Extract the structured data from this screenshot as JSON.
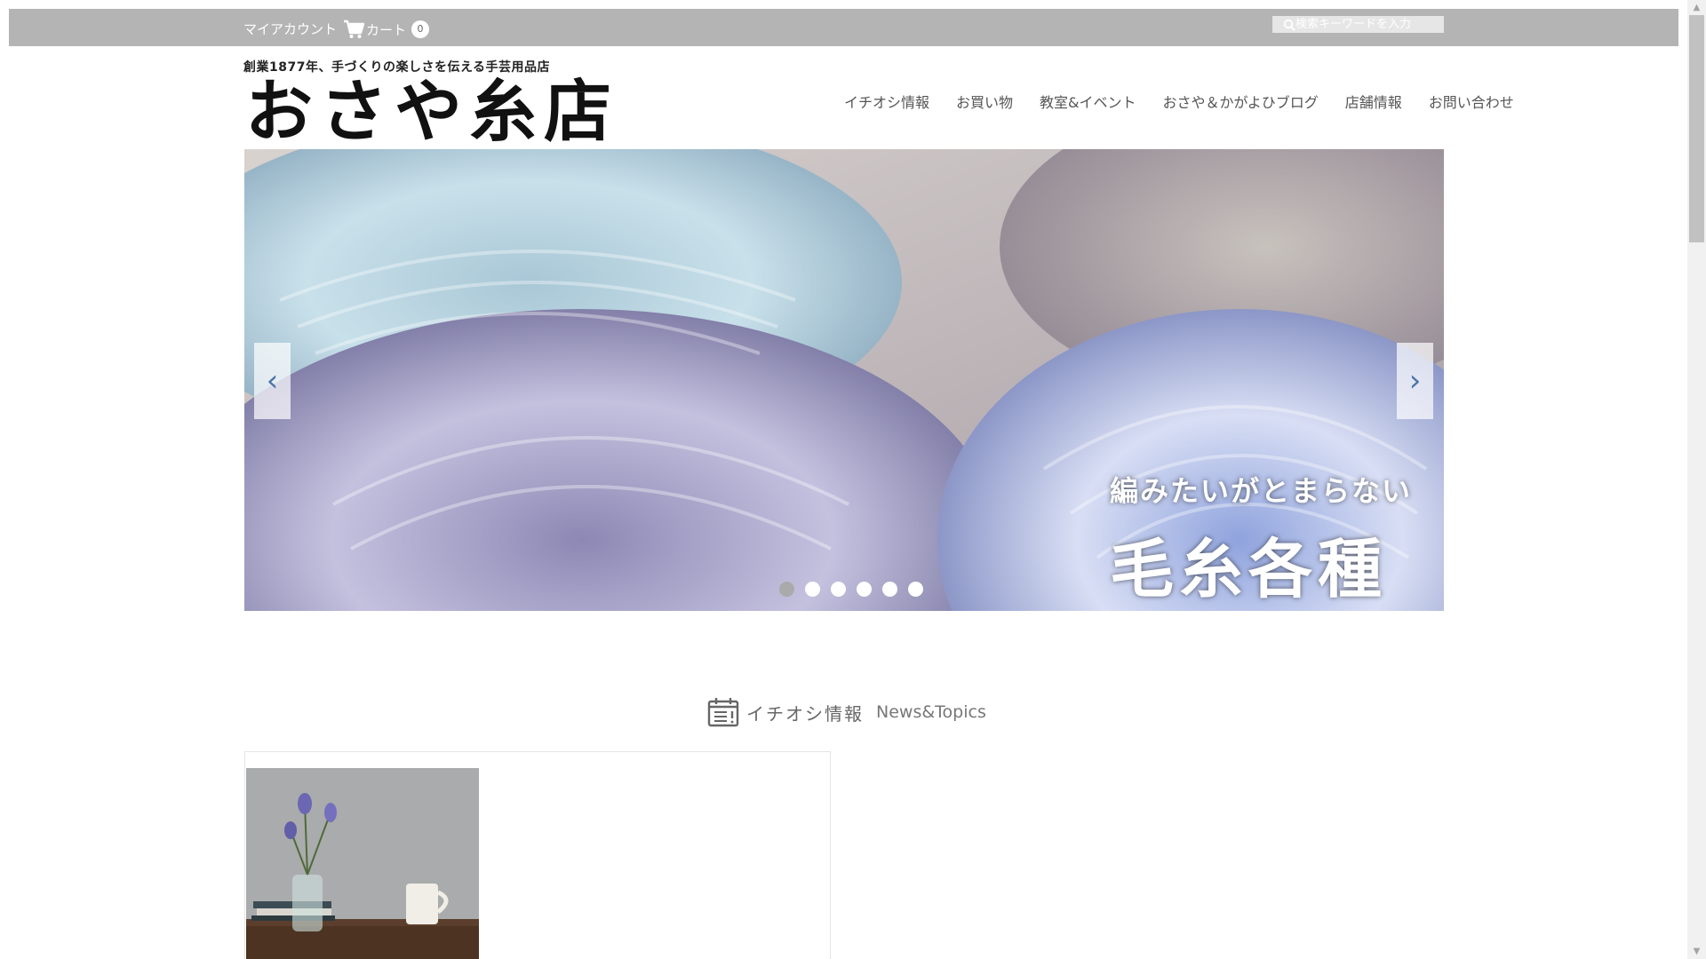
{
  "topbar": {
    "account_label": "マイアカウント",
    "cart_label": "カート",
    "cart_count": "0",
    "search_placeholder": "検索キーワードを入力"
  },
  "header": {
    "tagline": "創業1877年、手づくりの楽しさを伝える手芸用品店",
    "logo_text": "おさや糸店"
  },
  "nav": {
    "items": [
      {
        "label": "イチオシ情報"
      },
      {
        "label": "お買い物"
      },
      {
        "label": "教室&イベント"
      },
      {
        "label": "おさや＆かがよひブログ"
      },
      {
        "label": "店舗情報"
      },
      {
        "label": "お問い合わせ"
      }
    ]
  },
  "hero": {
    "caption_small": "編みたいがとまらない",
    "caption_big": "毛糸各種",
    "slide_count": 6,
    "active_slide": 1,
    "prev_icon": "chevron-left-icon",
    "next_icon": "chevron-right-icon"
  },
  "section": {
    "title_jp": "イチオシ情報",
    "title_en": "News&Topics",
    "icon": "calendar-icon"
  },
  "colors": {
    "topbar_bg": "#b4b4b4",
    "arrow_color": "#4b74a8"
  }
}
